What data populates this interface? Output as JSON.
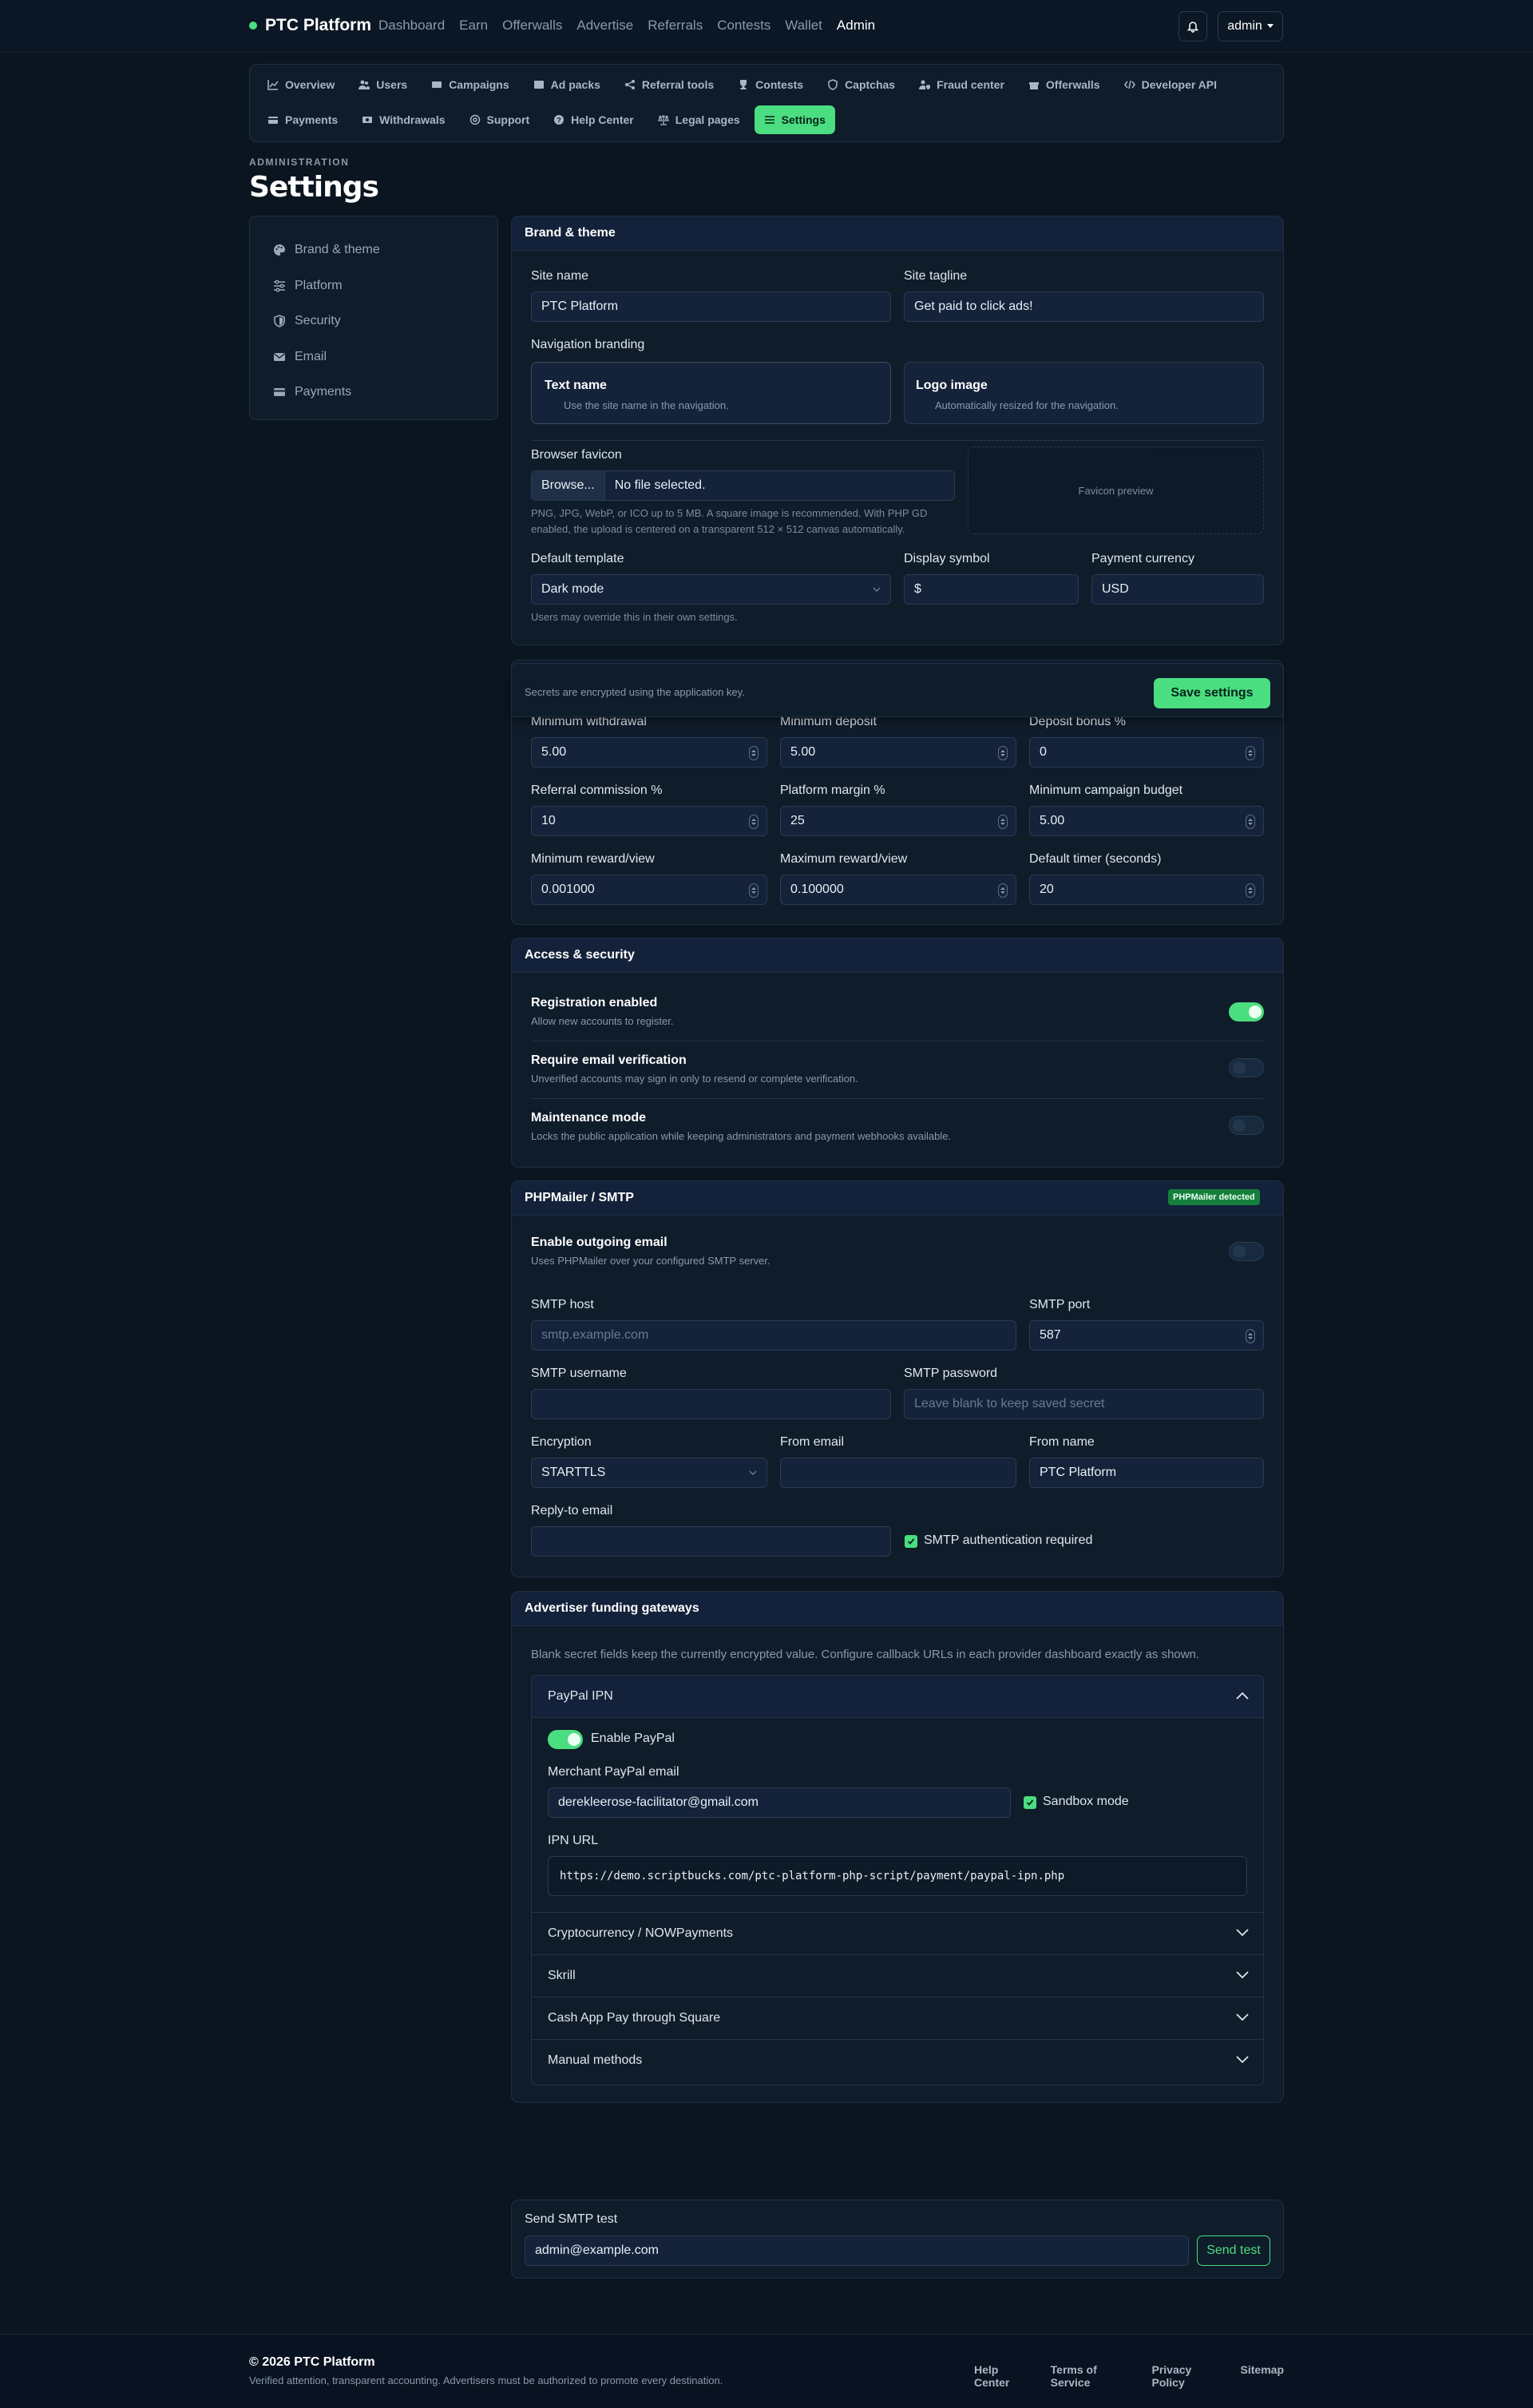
{
  "brand": {
    "name": "PTC Platform"
  },
  "topnav": [
    "Dashboard",
    "Earn",
    "Offerwalls",
    "Advertise",
    "Referrals",
    "Contests",
    "Wallet",
    "Admin"
  ],
  "user": {
    "name": "admin"
  },
  "admin_nav": {
    "row1": [
      "Overview",
      "Users",
      "Campaigns",
      "Ad packs",
      "Referral tools",
      "Contests",
      "Captchas",
      "Fraud center",
      "Offerwalls",
      "Developer API"
    ],
    "row2": [
      "Payments",
      "Withdrawals",
      "Support",
      "Help Center",
      "Legal pages",
      "Settings"
    ]
  },
  "page": {
    "eyebrow": "ADMINISTRATION",
    "title": "Settings"
  },
  "sidenav": [
    "Brand & theme",
    "Platform",
    "Security",
    "Email",
    "Payments"
  ],
  "brand_theme": {
    "title": "Brand & theme",
    "site_name_label": "Site name",
    "site_name": "PTC Platform",
    "tagline_label": "Site tagline",
    "tagline": "Get paid to click ads!",
    "nav_branding_label": "Navigation branding",
    "text_name_title": "Text name",
    "text_name_desc": "Use the site name in the navigation.",
    "logo_title": "Logo image",
    "logo_desc": "Automatically resized for the navigation.",
    "favicon_label": "Browser favicon",
    "browse_label": "Browse...",
    "no_file": "No file selected.",
    "favicon_help": "PNG, JPG, WebP, or ICO up to 5 MB. A square image is recommended. With PHP GD enabled, the upload is centered on a transparent 512 × 512 canvas automatically.",
    "favicon_preview": "Favicon preview",
    "template_label": "Default template",
    "template": "Dark mode",
    "template_help": "Users may override this in their own settings.",
    "symbol_label": "Display symbol",
    "symbol": "$",
    "currency_label": "Payment currency",
    "currency": "USD"
  },
  "savebar": {
    "text": "Secrets are encrypted using the application key.",
    "button": "Save settings"
  },
  "platform": {
    "min_withdrawal_label": "Minimum withdrawal",
    "min_withdrawal": "5.00",
    "min_deposit_label": "Minimum deposit",
    "min_deposit": "5.00",
    "deposit_bonus_label": "Deposit bonus %",
    "deposit_bonus": "0",
    "ref_commission_label": "Referral commission %",
    "ref_commission": "10",
    "margin_label": "Platform margin %",
    "margin": "25",
    "min_budget_label": "Minimum campaign budget",
    "min_budget": "5.00",
    "min_reward_label": "Minimum reward/view",
    "min_reward": "0.001000",
    "max_reward_label": "Maximum reward/view",
    "max_reward": "0.100000",
    "timer_label": "Default timer (seconds)",
    "timer": "20"
  },
  "security": {
    "title": "Access & security",
    "registration_title": "Registration enabled",
    "registration_desc": "Allow new accounts to register.",
    "registration_on": true,
    "verify_title": "Require email verification",
    "verify_desc": "Unverified accounts may sign in only to resend or complete verification.",
    "verify_on": false,
    "maint_title": "Maintenance mode",
    "maint_desc": "Locks the public application while keeping administrators and payment webhooks available.",
    "maint_on": false
  },
  "smtp": {
    "title": "PHPMailer / SMTP",
    "badge": "PHPMailer detected",
    "enable_title": "Enable outgoing email",
    "enable_desc": "Uses PHPMailer over your configured SMTP server.",
    "enable_on": false,
    "host_label": "SMTP host",
    "host_placeholder": "smtp.example.com",
    "port_label": "SMTP port",
    "port": "587",
    "username_label": "SMTP username",
    "username": "",
    "password_label": "SMTP password",
    "password_placeholder": "Leave blank to keep saved secret",
    "encryption_label": "Encryption",
    "encryption": "STARTTLS",
    "from_email_label": "From email",
    "from_email": "",
    "from_name_label": "From name",
    "from_name": "PTC Platform",
    "reply_to_label": "Reply-to email",
    "reply_to": "",
    "auth_label": "SMTP authentication required",
    "auth_checked": true
  },
  "gateways": {
    "title": "Advertiser funding gateways",
    "help": "Blank secret fields keep the currently encrypted value. Configure callback URLs in each provider dashboard exactly as shown.",
    "paypal": {
      "title": "PayPal IPN",
      "enable_label": "Enable PayPal",
      "enabled": true,
      "email_label": "Merchant PayPal email",
      "email": "derekleerose-facilitator@gmail.com",
      "sandbox_label": "Sandbox mode",
      "sandbox": true,
      "ipn_label": "IPN URL",
      "ipn_url": "https://demo.scriptbucks.com/ptc-platform-php-script/payment/paypal-ipn.php"
    },
    "collapsed": [
      "Cryptocurrency / NOWPayments",
      "Skrill",
      "Cash App Pay through Square",
      "Manual methods"
    ]
  },
  "smtp_test": {
    "label": "Send SMTP test",
    "email": "admin@example.com",
    "button": "Send test"
  },
  "footer": {
    "copyright": "© 2026 PTC Platform",
    "tagline": "Verified attention, transparent accounting. Advertisers must be authorized to promote every destination.",
    "links": [
      "Help Center",
      "Terms of Service",
      "Privacy Policy",
      "Sitemap"
    ]
  },
  "colors": {
    "accent": "#4ade80",
    "background": "#0a1520",
    "panel": "#0f1c2a"
  }
}
